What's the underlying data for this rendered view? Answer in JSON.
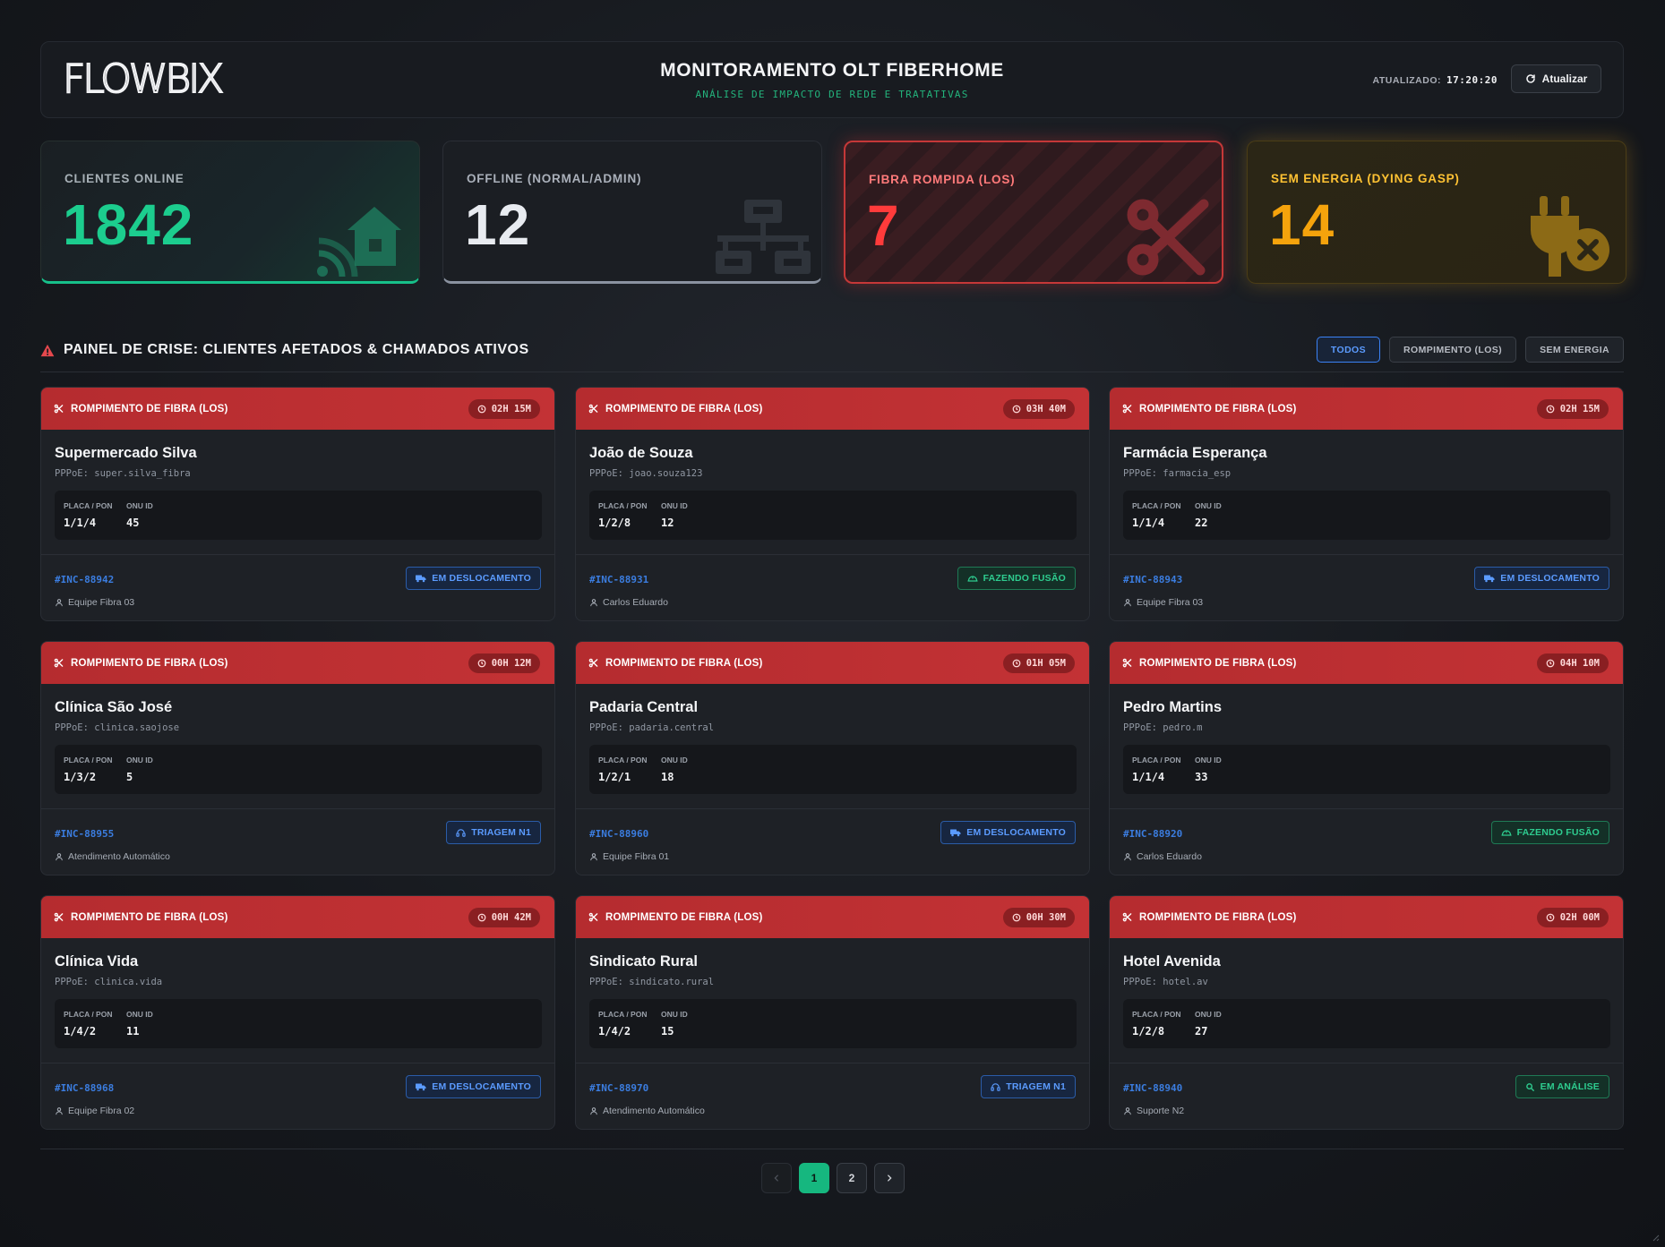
{
  "header": {
    "logo_text": "FLOWBIX",
    "title": "MONITORAMENTO OLT FIBERHOME",
    "subtitle": "ANÁLISE DE IMPACTO DE REDE E TRATATIVAS",
    "updated_label": "ATUALIZADO:",
    "updated_time": "17:20:20",
    "refresh_label": "Atualizar",
    "refresh_icon": "refresh-icon"
  },
  "kpis": [
    {
      "label": "CLIENTES ONLINE",
      "value": "1842",
      "icon": "home-wifi-icon",
      "color": "#1ccd8e"
    },
    {
      "label": "OFFLINE (NORMAL/ADMIN)",
      "value": "12",
      "icon": "network-icon",
      "color": "#e8ebf0"
    },
    {
      "label": "FIBRA ROMPIDA (LOS)",
      "value": "7",
      "icon": "scissors-icon",
      "color": "#ff3b3b"
    },
    {
      "label": "SEM ENERGIA (DYING GASP)",
      "value": "14",
      "icon": "plug-off-icon",
      "color": "#f5a30c"
    }
  ],
  "crisis": {
    "title": "PAINEL DE CRISE: CLIENTES AFETADOS & CHAMADOS ATIVOS",
    "icon": "warning-icon",
    "filters": [
      "TODOS",
      "ROMPIMENTO (LOS)",
      "SEM ENERGIA"
    ],
    "active_filter": "TODOS"
  },
  "card_labels": {
    "placa_pon": "PLACA / PON",
    "onu_id": "ONU ID"
  },
  "incidents": [
    {
      "type": "ROMPIMENTO DE FIBRA (LOS)",
      "time": "02H 15M",
      "name": "Supermercado Silva",
      "pppoe": "PPPoE: super.silva_fibra",
      "pon": "1/1/4",
      "onu": "45",
      "inc": "#INC-88942",
      "status": "EM DESLOCAMENTO",
      "status_kind": "blue",
      "status_icon": "truck-icon",
      "team": "Equipe Fibra 03"
    },
    {
      "type": "ROMPIMENTO DE FIBRA (LOS)",
      "time": "03H 40M",
      "name": "João de Souza",
      "pppoe": "PPPoE: joao.souza123",
      "pon": "1/2/8",
      "onu": "12",
      "inc": "#INC-88931",
      "status": "FAZENDO FUSÃO",
      "status_kind": "green",
      "status_icon": "hard-hat-icon",
      "team": "Carlos Eduardo"
    },
    {
      "type": "ROMPIMENTO DE FIBRA (LOS)",
      "time": "02H 15M",
      "name": "Farmácia Esperança",
      "pppoe": "PPPoE: farmacia_esp",
      "pon": "1/1/4",
      "onu": "22",
      "inc": "#INC-88943",
      "status": "EM DESLOCAMENTO",
      "status_kind": "blue",
      "status_icon": "truck-icon",
      "team": "Equipe Fibra 03"
    },
    {
      "type": "ROMPIMENTO DE FIBRA (LOS)",
      "time": "00H 12M",
      "name": "Clínica São José",
      "pppoe": "PPPoE: clinica.saojose",
      "pon": "1/3/2",
      "onu": "5",
      "inc": "#INC-88955",
      "status": "TRIAGEM N1",
      "status_kind": "blue",
      "status_icon": "headset-icon",
      "team": "Atendimento Automático"
    },
    {
      "type": "ROMPIMENTO DE FIBRA (LOS)",
      "time": "01H 05M",
      "name": "Padaria Central",
      "pppoe": "PPPoE: padaria.central",
      "pon": "1/2/1",
      "onu": "18",
      "inc": "#INC-88960",
      "status": "EM DESLOCAMENTO",
      "status_kind": "blue",
      "status_icon": "truck-icon",
      "team": "Equipe Fibra 01"
    },
    {
      "type": "ROMPIMENTO DE FIBRA (LOS)",
      "time": "04H 10M",
      "name": "Pedro Martins",
      "pppoe": "PPPoE: pedro.m",
      "pon": "1/1/4",
      "onu": "33",
      "inc": "#INC-88920",
      "status": "FAZENDO FUSÃO",
      "status_kind": "green",
      "status_icon": "hard-hat-icon",
      "team": "Carlos Eduardo"
    },
    {
      "type": "ROMPIMENTO DE FIBRA (LOS)",
      "time": "00H 42M",
      "name": "Clínica Vida",
      "pppoe": "PPPoE: clinica.vida",
      "pon": "1/4/2",
      "onu": "11",
      "inc": "#INC-88968",
      "status": "EM DESLOCAMENTO",
      "status_kind": "blue",
      "status_icon": "truck-icon",
      "team": "Equipe Fibra 02"
    },
    {
      "type": "ROMPIMENTO DE FIBRA (LOS)",
      "time": "00H 30M",
      "name": "Sindicato Rural",
      "pppoe": "PPPoE: sindicato.rural",
      "pon": "1/4/2",
      "onu": "15",
      "inc": "#INC-88970",
      "status": "TRIAGEM N1",
      "status_kind": "blue",
      "status_icon": "headset-icon",
      "team": "Atendimento Automático"
    },
    {
      "type": "ROMPIMENTO DE FIBRA (LOS)",
      "time": "02H 00M",
      "name": "Hotel Avenida",
      "pppoe": "PPPoE: hotel.av",
      "pon": "1/2/8",
      "onu": "27",
      "inc": "#INC-88940",
      "status": "EM ANÁLISE",
      "status_kind": "green",
      "status_icon": "search-icon",
      "team": "Suporte N2"
    }
  ],
  "pagination": {
    "pages": [
      "1",
      "2"
    ],
    "current": "1",
    "prev_icon": "chevron-left-icon",
    "next_icon": "chevron-right-icon"
  },
  "colors": {
    "accent_green": "#16b77f",
    "accent_red": "#c33235",
    "accent_blue": "#3b82f6",
    "accent_amber": "#f5a30c"
  }
}
